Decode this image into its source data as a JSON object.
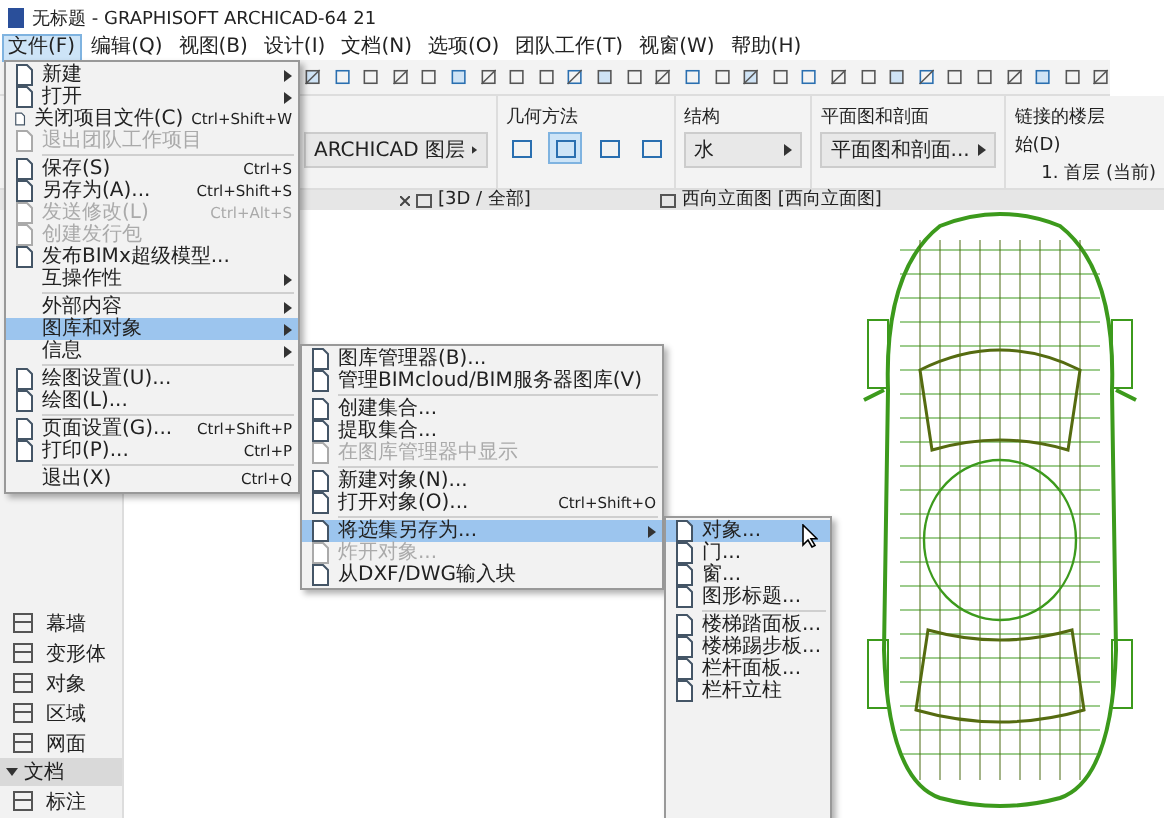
{
  "window": {
    "title": "无标题 - GRAPHISOFT ARCHICAD-64 21"
  },
  "menubar": [
    {
      "label": "文件(F)",
      "selected": true
    },
    {
      "label": "编辑(Q)",
      "selected": false
    },
    {
      "label": "视图(B)",
      "selected": false
    },
    {
      "label": "设计(I)",
      "selected": false
    },
    {
      "label": "文档(N)",
      "selected": false
    },
    {
      "label": "选项(O)",
      "selected": false
    },
    {
      "label": "团队工作(T)",
      "selected": false
    },
    {
      "label": "视窗(W)",
      "selected": false
    },
    {
      "label": "帮助(H)",
      "selected": false
    }
  ],
  "info_box": {
    "layer_field": "ARCHICAD 图层",
    "geometry_label": "几何方法",
    "geometry_methods": [
      {
        "selected": false
      },
      {
        "selected": true
      },
      {
        "selected": false
      },
      {
        "selected": false
      }
    ],
    "structure_label": "结构",
    "structure_field": "水",
    "floor_plan_label": "平面图和剖面",
    "floor_plan_field": "平面图和剖面...",
    "linked_story_label": "链接的楼层",
    "home_label": "始(D)",
    "story_value": "1. 首层 (当前)"
  },
  "view_tabs": [
    {
      "label": "[3D / 全部]"
    },
    {
      "label": "西向立面图 [西向立面图]"
    }
  ],
  "toolbox": [
    {
      "kind": "tool",
      "label": "幕墙"
    },
    {
      "kind": "tool",
      "label": "变形体"
    },
    {
      "kind": "tool",
      "label": "对象"
    },
    {
      "kind": "tool",
      "label": "区域"
    },
    {
      "kind": "tool",
      "label": "网面"
    },
    {
      "kind": "section",
      "label": "文档",
      "expanded": true
    },
    {
      "kind": "tool",
      "label": "标注"
    }
  ],
  "file_menu": [
    {
      "kind": "item",
      "label": "新建",
      "submenu": true,
      "disabled": false,
      "selected": false
    },
    {
      "kind": "item",
      "label": "打开",
      "submenu": true,
      "disabled": false,
      "selected": false
    },
    {
      "kind": "item",
      "label": "关闭项目文件(C)",
      "shortcut": "Ctrl+Shift+W",
      "submenu": false,
      "disabled": false,
      "selected": false
    },
    {
      "kind": "item",
      "label": "退出团队工作项目",
      "submenu": false,
      "disabled": true,
      "selected": false
    },
    {
      "kind": "separator"
    },
    {
      "kind": "item",
      "label": "保存(S)",
      "shortcut": "Ctrl+S",
      "submenu": false,
      "disabled": false,
      "selected": false
    },
    {
      "kind": "item",
      "label": "另存为(A)...",
      "shortcut": "Ctrl+Shift+S",
      "submenu": false,
      "disabled": false,
      "selected": false
    },
    {
      "kind": "item",
      "label": "发送修改(L)",
      "shortcut": "Ctrl+Alt+S",
      "submenu": false,
      "disabled": true,
      "selected": false
    },
    {
      "kind": "item",
      "label": "创建发行包",
      "submenu": false,
      "disabled": true,
      "selected": false
    },
    {
      "kind": "item",
      "label": "发布BIMx超级模型...",
      "submenu": false,
      "disabled": false,
      "selected": false
    },
    {
      "kind": "item",
      "label": "互操作性",
      "submenu": true,
      "disabled": false,
      "selected": false,
      "no_icon": true
    },
    {
      "kind": "separator"
    },
    {
      "kind": "item",
      "label": "外部内容",
      "submenu": true,
      "disabled": false,
      "selected": false,
      "no_icon": true
    },
    {
      "kind": "item",
      "label": "图库和对象",
      "submenu": true,
      "disabled": false,
      "selected": true,
      "no_icon": true
    },
    {
      "kind": "item",
      "label": "信息",
      "submenu": true,
      "disabled": false,
      "selected": false,
      "no_icon": true
    },
    {
      "kind": "separator"
    },
    {
      "kind": "item",
      "label": "绘图设置(U)...",
      "submenu": false,
      "disabled": false,
      "selected": false
    },
    {
      "kind": "item",
      "label": "绘图(L)...",
      "submenu": false,
      "disabled": false,
      "selected": false
    },
    {
      "kind": "separator"
    },
    {
      "kind": "item",
      "label": "页面设置(G)...",
      "shortcut": "Ctrl+Shift+P",
      "submenu": false,
      "disabled": false,
      "selected": false
    },
    {
      "kind": "item",
      "label": "打印(P)...",
      "shortcut": "Ctrl+P",
      "submenu": false,
      "disabled": false,
      "selected": false
    },
    {
      "kind": "separator"
    },
    {
      "kind": "item",
      "label": "退出(X)",
      "shortcut": "Ctrl+Q",
      "submenu": false,
      "disabled": false,
      "selected": false,
      "no_icon": true
    }
  ],
  "library_submenu": [
    {
      "kind": "item",
      "label": "图库管理器(B)...",
      "submenu": false,
      "disabled": false,
      "selected": false
    },
    {
      "kind": "item",
      "label": "管理BIMcloud/BIM服务器图库(V)",
      "submenu": false,
      "disabled": false,
      "selected": false
    },
    {
      "kind": "separator"
    },
    {
      "kind": "item",
      "label": "创建集合...",
      "submenu": false,
      "disabled": false,
      "selected": false
    },
    {
      "kind": "item",
      "label": "提取集合...",
      "submenu": false,
      "disabled": false,
      "selected": false
    },
    {
      "kind": "item",
      "label": "在图库管理器中显示",
      "submenu": false,
      "disabled": true,
      "selected": false
    },
    {
      "kind": "separator"
    },
    {
      "kind": "item",
      "label": "新建对象(N)...",
      "submenu": false,
      "disabled": false,
      "selected": false
    },
    {
      "kind": "item",
      "label": "打开对象(O)...",
      "shortcut": "Ctrl+Shift+O",
      "submenu": false,
      "disabled": false,
      "selected": false
    },
    {
      "kind": "separator"
    },
    {
      "kind": "item",
      "label": "将选集另存为...",
      "submenu": true,
      "disabled": false,
      "selected": true
    },
    {
      "kind": "item",
      "label": "炸开对象...",
      "submenu": false,
      "disabled": true,
      "selected": false
    },
    {
      "kind": "item",
      "label": "从DXF/DWG输入块",
      "submenu": false,
      "disabled": false,
      "selected": false
    }
  ],
  "save_selection_submenu": [
    {
      "kind": "item",
      "label": "对象...",
      "submenu": false,
      "disabled": false,
      "selected": true
    },
    {
      "kind": "item",
      "label": "门...",
      "submenu": false,
      "disabled": false,
      "selected": false
    },
    {
      "kind": "item",
      "label": "窗...",
      "submenu": false,
      "disabled": false,
      "selected": false
    },
    {
      "kind": "item",
      "label": "图形标题...",
      "submenu": false,
      "disabled": false,
      "selected": false
    },
    {
      "kind": "separator"
    },
    {
      "kind": "item",
      "label": "楼梯踏面板...",
      "submenu": false,
      "disabled": false,
      "selected": false
    },
    {
      "kind": "item",
      "label": "楼梯踢步板...",
      "submenu": false,
      "disabled": false,
      "selected": false
    },
    {
      "kind": "item",
      "label": "栏杆面板...",
      "submenu": false,
      "disabled": false,
      "selected": false
    },
    {
      "kind": "item",
      "label": "栏杆立柱",
      "submenu": false,
      "disabled": false,
      "selected": false
    }
  ]
}
